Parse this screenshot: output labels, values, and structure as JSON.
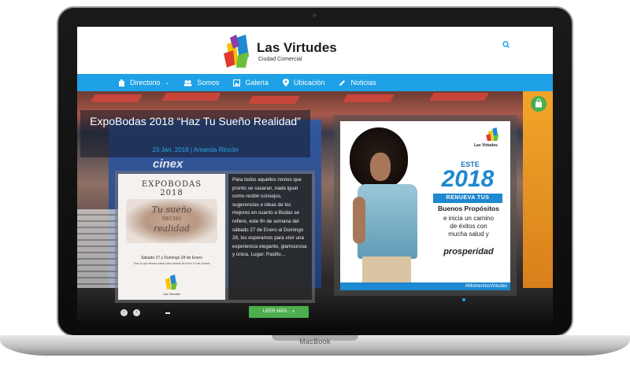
{
  "device": {
    "label": "MacBook"
  },
  "header": {
    "logo_title": "Las Virtudes",
    "logo_subtitle": "Ciudad Comercial"
  },
  "nav": {
    "items": [
      {
        "label": "Directorio",
        "icon": "building-icon",
        "has_dropdown": true
      },
      {
        "label": "Somos",
        "icon": "users-icon"
      },
      {
        "label": "Galería",
        "icon": "image-icon"
      },
      {
        "label": "Ubicación",
        "icon": "map-pin-icon"
      },
      {
        "label": "Noticias",
        "icon": "pencil-icon"
      }
    ]
  },
  "slide": {
    "title": "ExpoBodas 2018 “Haz Tu Sueño Realidad”",
    "meta": "23 Jan, 2018 | Amanda Rincón",
    "excerpt": "Para todos aquellos novios que pronto se casaran, nada igual como recibir consejos, sugerencias e ideas de los mejores en cuanto a Bodas se refiere, este fin de semana del sábado 27 de Enero al Domingo 28, los esperamos para vivir una experiencia elegante, glamourosa y única. Lugar: Pasillo…",
    "read_more": "LEER MÁS...",
    "read_more_arrow": "»",
    "flyer": {
      "title_line1": "EXPOBODAS",
      "title_line2": "2018",
      "script_line1": "Tu sueño",
      "script_line2": "HECHO",
      "script_line3": "realidad",
      "date": "Sábado 27 y Domingo 28 de Enero",
      "note": "Todo lo que desees saber para casarte tal como lo has soñado",
      "logo_text": "Las Virtudes"
    }
  },
  "promo": {
    "logo_text": "Las Virtudes",
    "este": "ESTE",
    "year": "2018",
    "renueva": "RENUEVA TUS",
    "buenos": "Buenos Propósitos",
    "line1": "e inicia un camino",
    "line2": "de éxitos con",
    "line3": "mucha salud y",
    "prosperidad": "prosperidad",
    "hashtag": "#MomentosVirtudes"
  },
  "colors": {
    "nav_blue": "#1ea1e6",
    "green": "#4cae4c",
    "link_blue": "#29a6e6"
  }
}
